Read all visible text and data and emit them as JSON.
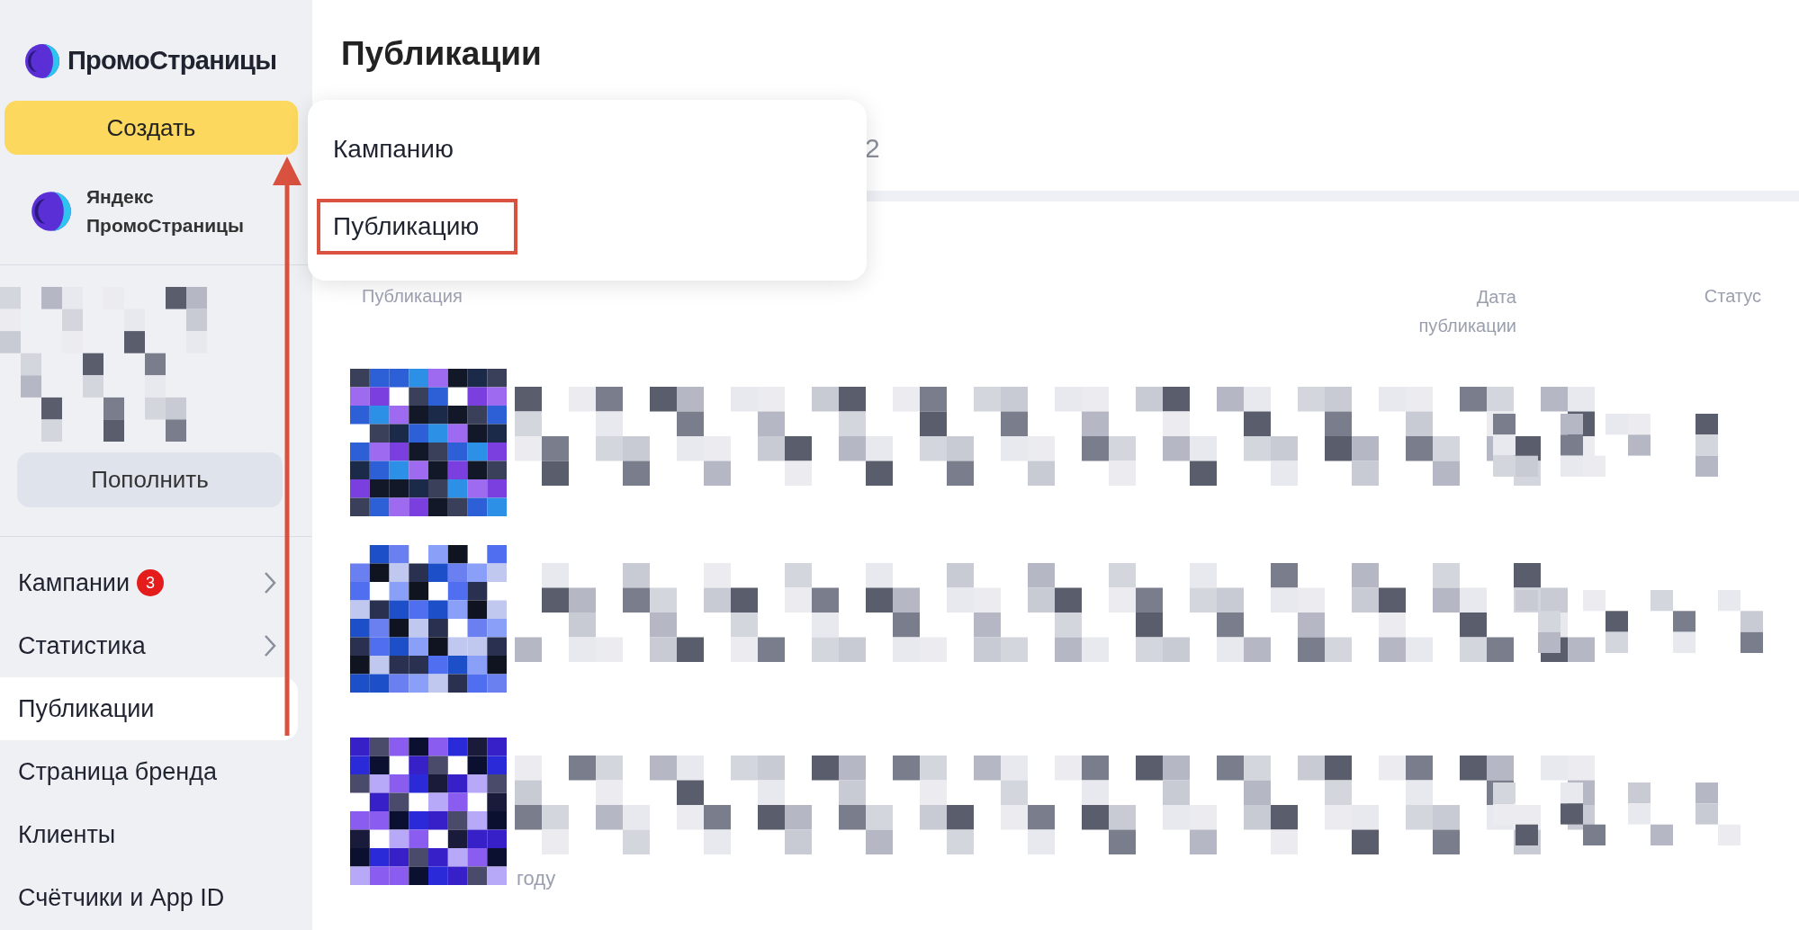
{
  "logo": {
    "text": "ПромоСтраницы"
  },
  "create_button": "Создать",
  "account": {
    "line1": "Яндекс",
    "line2": "ПромоСтраницы"
  },
  "top_up_button": "Пополнить",
  "nav": [
    {
      "label": "Кампании",
      "badge": "3",
      "has_arrow": true,
      "selected": false
    },
    {
      "label": "Статистика",
      "has_arrow": true,
      "selected": false
    },
    {
      "label": "Публикации",
      "has_arrow": false,
      "selected": true
    },
    {
      "label": "Страница бренда",
      "has_arrow": false,
      "selected": false
    },
    {
      "label": "Клиенты",
      "has_arrow": false,
      "selected": false
    },
    {
      "label": "Счётчики и App ID",
      "has_arrow": false,
      "selected": false
    }
  ],
  "page_title": "Публикации",
  "dropdown": {
    "items": [
      {
        "label": "Кампанию",
        "highlighted": false
      },
      {
        "label": "Публикацию",
        "highlighted": true
      }
    ]
  },
  "tab_fragment": "2",
  "table": {
    "columns": [
      "Публикация",
      "Дата публикации",
      "Статус"
    ],
    "trailing_text": "году"
  }
}
